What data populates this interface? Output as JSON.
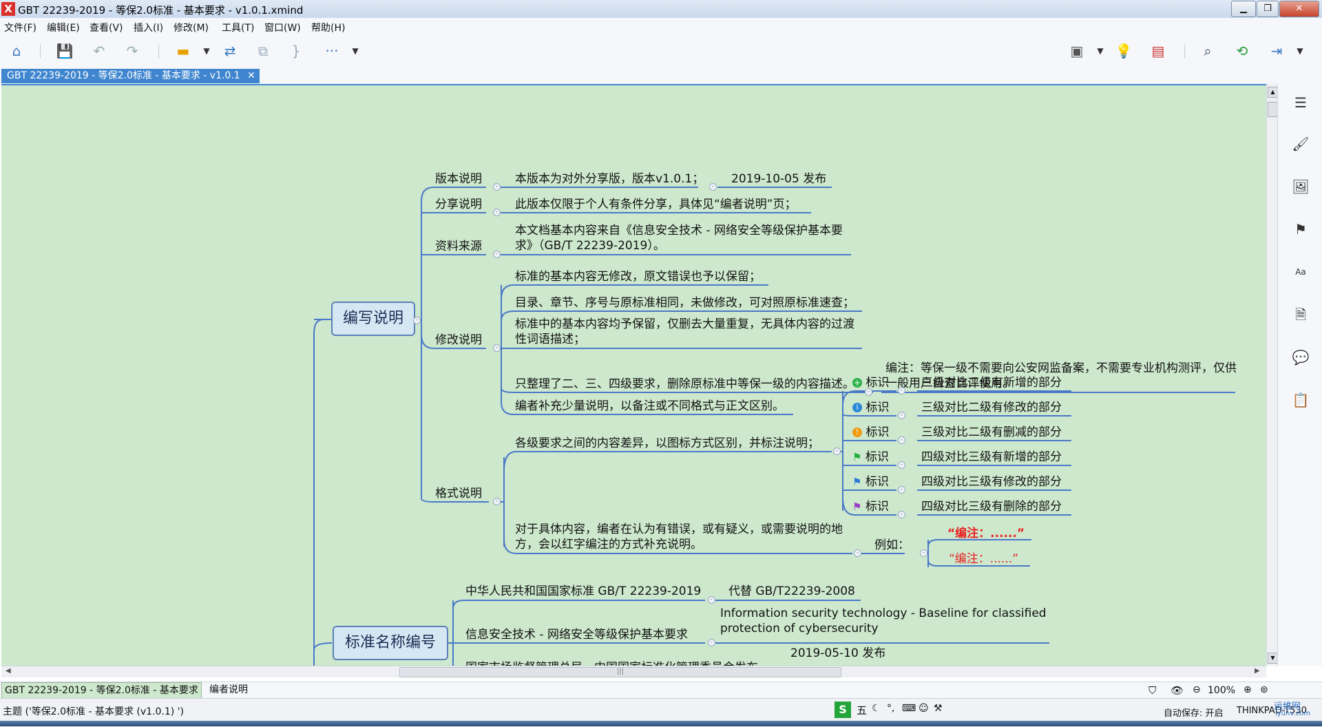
{
  "window": {
    "title": "GBT 22239-2019 - 等保2.0标准 - 基本要求 - v1.0.1.xmind",
    "app_logo": "X"
  },
  "menu": [
    "文件(F)",
    "编辑(E)",
    "查看(V)",
    "插入(I)",
    "修改(M)",
    "工具(T)",
    "窗口(W)",
    "帮助(H)"
  ],
  "toolbar": {
    "more_glyph": "···"
  },
  "tab": {
    "label": "GBT 22239-2019 - 等保2.0标准 - 基本要求 - v1.0.1",
    "close": "✕"
  },
  "map": {
    "topic1": "编写说明",
    "topic2": "标准名称编号",
    "b1": {
      "label": "版本说明",
      "c1": "本版本为对外分享版，版本v1.0.1；",
      "c2": "2019-10-05 发布"
    },
    "b2": {
      "label": "分享说明",
      "c1": "此版本仅限于个人有条件分享，具体见“编者说明”页；"
    },
    "b3": {
      "label": "资料来源",
      "c1": "本文档基本内容来自《信息安全技术 - 网络安全等级保护基本要求》（GB/T 22239-2019）。"
    },
    "b4": {
      "label": "修改说明",
      "c1": "标准的基本内容无修改，原文错误也予以保留；",
      "c2": "目录、章节、序号与原标准相同，未做修改，可对照原标准速查；",
      "c3": "标准中的基本内容均予保留，仅删去大量重复，无具体内容的过渡性词语描述；",
      "c4": "只整理了二、三、四级要求，删除原标准中等保一级的内容描述。",
      "c4note": "编注：等保一级不需要向公安网监备案，不需要专业机构测评，仅供一般用户自查自评使用。",
      "c5": "编者补充少量说明，以备注或不同格式与正文区别。"
    },
    "b5": {
      "label": "格式说明",
      "c1": "各级要求之间的内容差异，以图标方式区别，并标注说明；",
      "marks": [
        {
          "icon": "plus-circle-icon",
          "label": "标识",
          "desc": "三级对比二级有新增的部分",
          "color": "#2fb24b"
        },
        {
          "icon": "info-circle-icon",
          "label": "标识",
          "desc": "三级对比二级有修改的部分",
          "color": "#2b8ad6"
        },
        {
          "icon": "exclaim-circle-icon",
          "label": "标识",
          "desc": "三级对比二级有删减的部分",
          "color": "#f29a12"
        },
        {
          "icon": "flag-green-icon",
          "label": "标识",
          "desc": "四级对比三级有新增的部分",
          "color": "#1fae3a"
        },
        {
          "icon": "flag-blue-icon",
          "label": "标识",
          "desc": "四级对比三级有修改的部分",
          "color": "#2b7bd6"
        },
        {
          "icon": "flag-purple-icon",
          "label": "标识",
          "desc": "四级对比三级有删除的部分",
          "color": "#9a3cc8"
        }
      ],
      "c2": "对于具体内容，编者在认为有错误，或有疑义，或需要说明的地方，会以红字编注的方式补充说明。",
      "example": "例如：",
      "ex1": "“编注：......”",
      "ex2": "“编注：......”"
    },
    "n1": {
      "c1": "中华人民共和国国家标准 GB/T 22239-2019",
      "c2": "代替 GB/T22239-2008"
    },
    "n2": {
      "c1": "信息安全技术 - 网络安全等级保护基本要求",
      "c2": "Information security technology  - Baseline for classified protection of cybersecurity"
    },
    "n3": {
      "c1": "国家市场监督管理总局，中国国家标准化管理委员会发布",
      "c2": "2019-05-10 发布"
    }
  },
  "sheets": [
    "GBT 22239-2019 - 等保2.0标准 - 基本要求",
    "编者说明"
  ],
  "status": {
    "left": "主题 ('等保2.0标准 - 基本要求 (v1.0.1) ')",
    "zoom": "100%",
    "autosave": "自动保存: 开启",
    "device": "THINKPAD-T530",
    "ime": "五",
    "watermark": "运维网",
    "watermark_sub": "iyunv.com"
  }
}
